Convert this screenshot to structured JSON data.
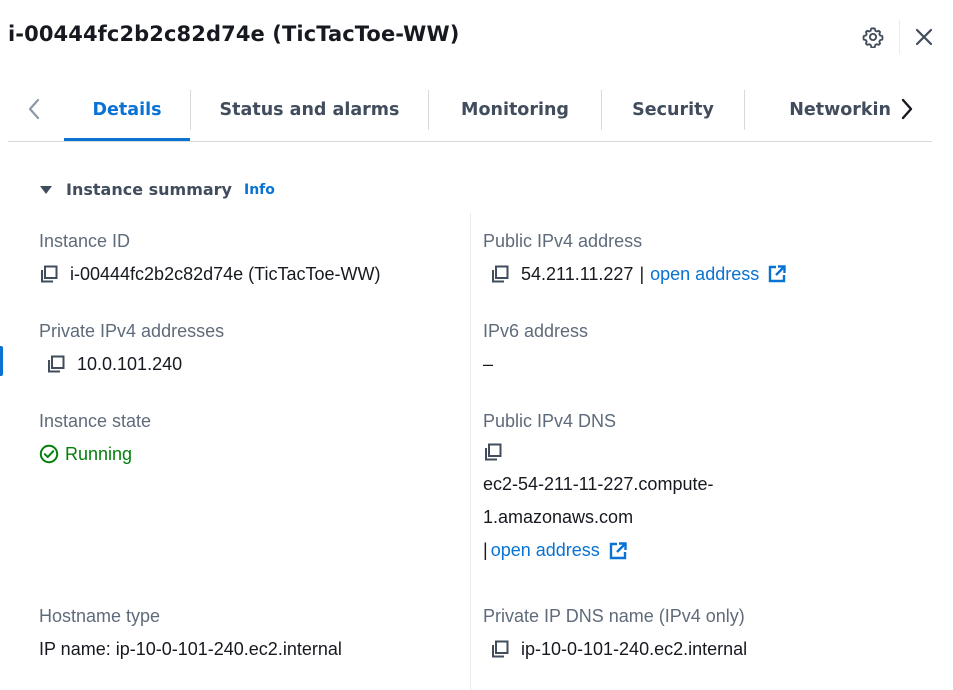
{
  "panel": {
    "title": "i-00444fc2b2c82d74e (TicTacToe-WW)"
  },
  "tabs": [
    {
      "label": "Details",
      "active": true
    },
    {
      "label": "Status and alarms",
      "active": false
    },
    {
      "label": "Monitoring",
      "active": false
    },
    {
      "label": "Security",
      "active": false
    },
    {
      "label": "Networkin",
      "active": false
    }
  ],
  "section": {
    "title": "Instance summary",
    "info": "Info"
  },
  "fields": {
    "instance_id": {
      "label": "Instance ID",
      "value": "i-00444fc2b2c82d74e (TicTacToe-WW)"
    },
    "public_ipv4": {
      "label": "Public IPv4 address",
      "value": "54.211.11.227",
      "sep": "|",
      "link": "open address"
    },
    "private_ipv4": {
      "label": "Private IPv4 addresses",
      "value": "10.0.101.240"
    },
    "ipv6": {
      "label": "IPv6 address",
      "value": "–"
    },
    "instance_state": {
      "label": "Instance state",
      "value": "Running"
    },
    "public_dns": {
      "label": "Public IPv4 DNS",
      "line1": "ec2-54-211-11-227.compute-",
      "line2": "1.amazonaws.com",
      "sep": "|",
      "link": "open address"
    },
    "hostname_type": {
      "label": "Hostname type",
      "value": "IP name: ip-10-0-101-240.ec2.internal"
    },
    "private_dns": {
      "label": "Private IP DNS name (IPv4 only)",
      "value": "ip-10-0-101-240.ec2.internal"
    }
  },
  "colors": {
    "accent": "#0972d3",
    "success": "#037f0c",
    "label": "#5f6b7a",
    "text": "#16191f"
  },
  "icons": [
    "settings-gear-icon",
    "close-icon",
    "chevron-left-icon",
    "chevron-right-icon",
    "caret-down-icon",
    "copy-icon",
    "external-link-icon",
    "status-check-icon"
  ]
}
